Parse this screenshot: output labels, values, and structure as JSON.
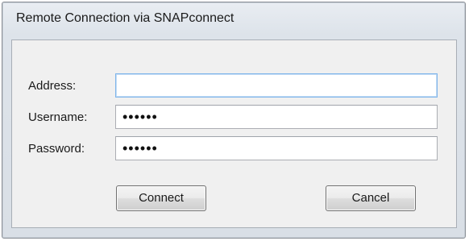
{
  "window": {
    "title": "Remote Connection via SNAPconnect"
  },
  "form": {
    "address": {
      "label": "Address:",
      "value": ""
    },
    "username": {
      "label": "Username:",
      "value": "••••••"
    },
    "password": {
      "label": "Password:",
      "value": "••••••"
    }
  },
  "buttons": {
    "connect_label": "Connect",
    "cancel_label": "Cancel"
  }
}
